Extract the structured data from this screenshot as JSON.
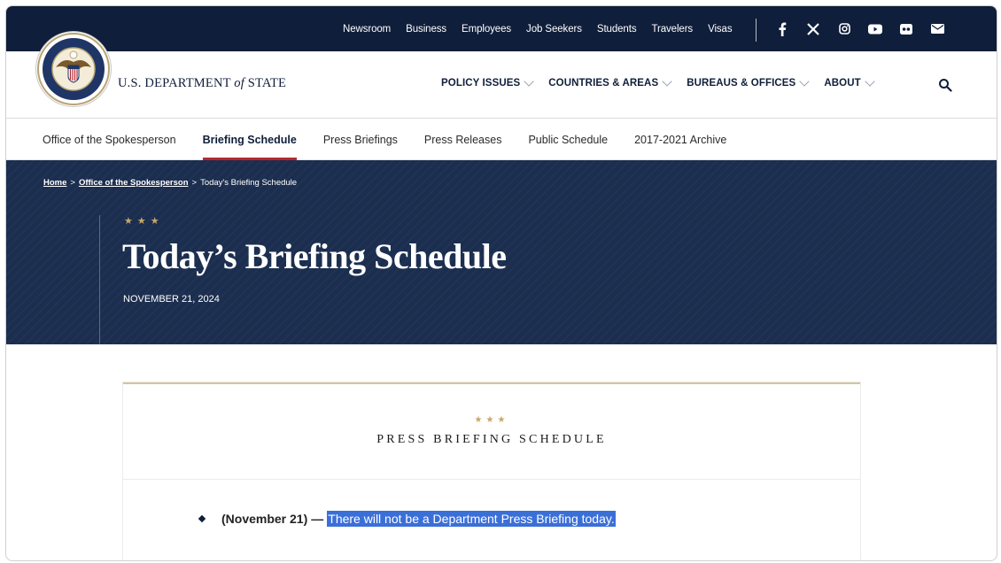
{
  "utility": {
    "links": [
      "Newsroom",
      "Business",
      "Employees",
      "Job Seekers",
      "Students",
      "Travelers",
      "Visas"
    ],
    "social_icons": [
      "facebook-icon",
      "x-icon",
      "instagram-icon",
      "youtube-icon",
      "flickr-icon",
      "email-icon"
    ]
  },
  "header": {
    "title_prefix": "U.S. DEPARTMENT ",
    "title_of": "of",
    "title_suffix": " STATE",
    "nav": [
      "POLICY ISSUES",
      "COUNTRIES & AREAS",
      "BUREAUS & OFFICES",
      "ABOUT"
    ]
  },
  "subnav": {
    "items": [
      "Office of the Spokesperson",
      "Briefing Schedule",
      "Press Briefings",
      "Press Releases",
      "Public Schedule",
      "2017-2021 Archive"
    ],
    "active": "Briefing Schedule"
  },
  "breadcrumb": {
    "home": "Home",
    "sep1": ">",
    "office": "Office of the Spokesperson",
    "sep2": ">",
    "current": "Today's Briefing Schedule"
  },
  "hero": {
    "stars": "★★★",
    "title": "Today’s Briefing Schedule",
    "date": "NOVEMBER 21, 2024"
  },
  "card": {
    "stars": "★★★",
    "title": "PRESS BRIEFING SCHEDULE",
    "item_date": "(November 21)",
    "item_dash": "—",
    "item_text": "There will not be a Department Press Briefing today."
  },
  "colors": {
    "navy": "#0f1e3a",
    "hero_bg": "#1c2e4f",
    "accent_red": "#b5282e",
    "gold": "#c8a76b",
    "selection": "#3b6fd8"
  }
}
